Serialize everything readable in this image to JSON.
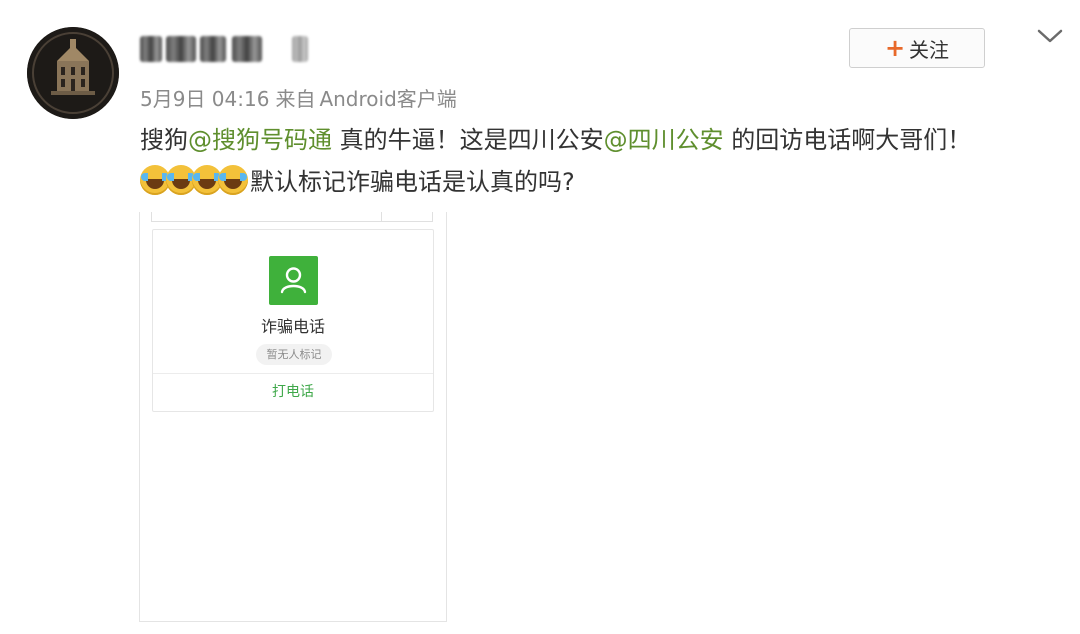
{
  "post": {
    "username": "",
    "meta": {
      "time": "5月9日 04:16",
      "source_prefix": "来自",
      "source": "Android客户端"
    },
    "follow_label": "关注",
    "text": {
      "part1": "搜狗",
      "mention1": "@搜狗号码通",
      "part2": " 真的牛逼！这是四川公安",
      "mention2": "@四川公安",
      "part3": " 的回访电话啊大哥们！",
      "part4": "默认标记诈骗电话是认真的吗?"
    },
    "emoji_icon": "laugh-cry-emoji",
    "emoji_count": 4
  },
  "image_card": {
    "title": "诈骗电话",
    "tag": "暂无人标记",
    "call_label": "打电话",
    "icon": "contact-person-icon",
    "icon_color": "#3fb13b",
    "call_color": "#3fa84a"
  },
  "colors": {
    "mention": "#5f8f2e",
    "follow_plus": "#e8692a",
    "meta": "#8a8a8a"
  }
}
